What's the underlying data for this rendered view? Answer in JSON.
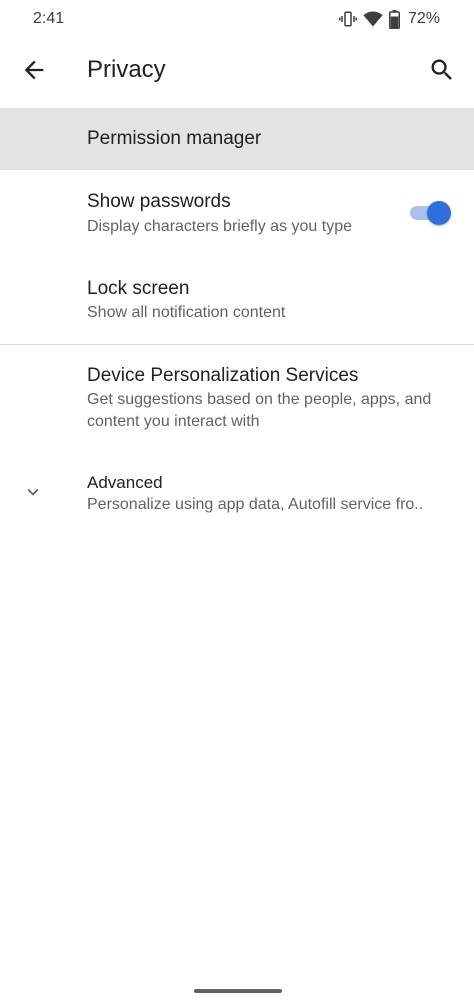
{
  "status_bar": {
    "time": "2:41",
    "battery_percent": "72%",
    "icons": [
      "vibrate-icon",
      "wifi-icon",
      "battery-icon"
    ]
  },
  "app_bar": {
    "title": "Privacy",
    "back_icon": "back-arrow-icon",
    "search_icon": "search-icon"
  },
  "preferences": {
    "permission_manager": {
      "title": "Permission manager"
    },
    "show_passwords": {
      "title": "Show passwords",
      "summary": "Display characters briefly as you type",
      "toggle_on": true
    },
    "lock_screen": {
      "title": "Lock screen",
      "summary": "Show all notification content"
    },
    "device_personalization": {
      "title": "Device Personalization Services",
      "summary": "Get suggestions based on the people, apps, and content you interact with"
    },
    "advanced": {
      "title": "Advanced",
      "summary": "Personalize using app data, Autofill service fro.."
    }
  },
  "colors": {
    "accent": "#2f6fdc",
    "toggle_track": "#a9c1f0",
    "highlight_row": "#e3e3e3"
  }
}
